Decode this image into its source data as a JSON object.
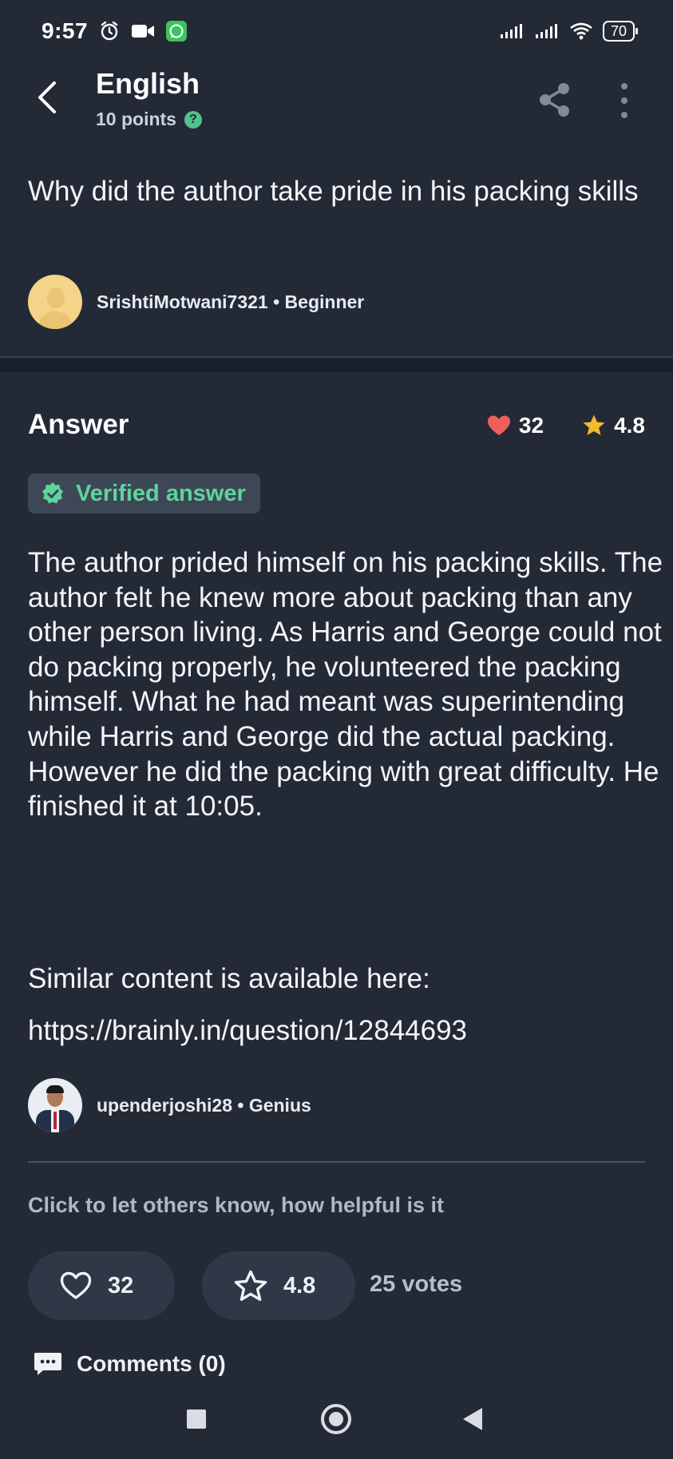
{
  "status_bar": {
    "time": "9:57",
    "battery": "70",
    "icons_left": [
      "alarm-icon",
      "video-camera-icon",
      "whatsapp-icon"
    ],
    "icons_right": [
      "signal-icon",
      "signal-icon",
      "wifi-icon",
      "battery-icon"
    ]
  },
  "header": {
    "title": "English",
    "points": "10 points",
    "help_glyph": "?"
  },
  "question": {
    "text": "Why did the author take pride in his packing skills",
    "author": "SrishtiMotwani7321 • Beginner"
  },
  "answer": {
    "heading": "Answer",
    "likes": "32",
    "rating": "4.8",
    "verified_label": "Verified answer",
    "body": "The author prided himself on his packing skills. The author felt he knew more about packing than any other person living. As Harris and George could not do packing properly, he volunteered the packing himself. What he had meant was superintending while Harris and George did the actual packing. However he did the packing with great difficulty. He finished it at 10:05.",
    "similar_label": "Similar content is available here:",
    "similar_link": "https://brainly.in/question/12844693",
    "author": "upenderjoshi28 • Genius"
  },
  "feedback": {
    "prompt": "Click to let others know, how helpful is it",
    "like_count": "32",
    "star_value": "4.8",
    "votes": "25 votes"
  },
  "comments": {
    "label": "Comments (0)"
  },
  "colors": {
    "background": "#232a36",
    "verified_green": "#5fd49d",
    "heart_red": "#f0605a",
    "star_gold": "#f5b92e"
  }
}
